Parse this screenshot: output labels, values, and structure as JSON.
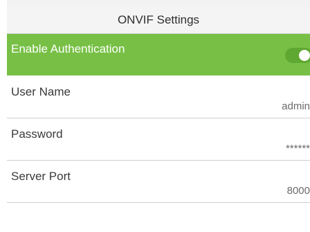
{
  "header": {
    "title": "ONVIF Settings"
  },
  "settings": [
    {
      "label": "Enable Authentication",
      "type": "toggle",
      "enabled": true
    },
    {
      "label": "User Name",
      "value": "admin"
    },
    {
      "label": "Password",
      "value": "******"
    },
    {
      "label": "Server Port",
      "value": "8000"
    }
  ],
  "colors": {
    "highlight": "#77c045",
    "toggle_on": "#5fa832"
  }
}
